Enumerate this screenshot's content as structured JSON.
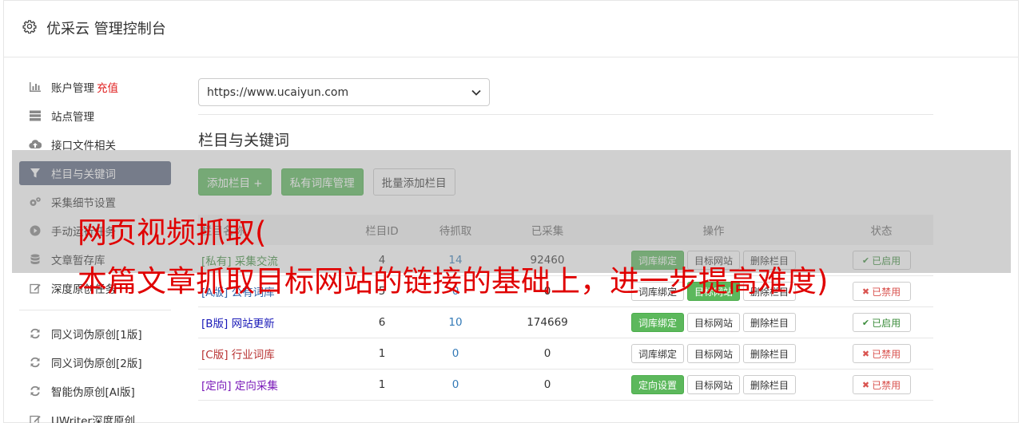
{
  "header": {
    "title": "优采云 管理控制台",
    "icon": "gear-icon"
  },
  "sidebar": {
    "items": [
      {
        "label": "账户管理",
        "extra": "充值",
        "icon": "bar-chart-icon"
      },
      {
        "label": "站点管理",
        "icon": "server-icon"
      },
      {
        "label": "接口文件相关",
        "icon": "cloud-upload-icon"
      },
      {
        "label": "栏目与关键词",
        "icon": "filter-icon"
      },
      {
        "label": "采集细节设置",
        "icon": "cogs-icon"
      },
      {
        "label": "手动运行任务",
        "icon": "play-circle-icon"
      },
      {
        "label": "文章暂存库",
        "icon": "database-icon"
      },
      {
        "label": "深度原创任务",
        "icon": "edit-icon"
      }
    ],
    "items2": [
      {
        "label": "同义词伪原创[1版]",
        "icon": "refresh-icon"
      },
      {
        "label": "同义词伪原创[2版]",
        "icon": "refresh-icon"
      },
      {
        "label": "智能伪原创[AI版]",
        "icon": "refresh-icon"
      },
      {
        "label": "UWriter深度原创",
        "icon": "edit-icon"
      }
    ]
  },
  "main": {
    "site_select": "https://www.ucaiyun.com",
    "section_title": "栏目与关键词",
    "buttons": {
      "add": "添加栏目 +",
      "private": "私有词库管理",
      "batch": "批量添加栏目"
    }
  },
  "table": {
    "headers": {
      "name": "栏目名称",
      "id": "栏目ID",
      "wait": "待抓取",
      "collected": "已采集",
      "ops": "操作",
      "status": "状态"
    },
    "rows": [
      {
        "tag": "[私有]",
        "name": "采集交流",
        "id": "4",
        "wait": "14",
        "collected": "92460",
        "op1": "词库绑定",
        "op1_style": "green",
        "op2": "目标网站",
        "op3": "删除栏目",
        "status": "已启用",
        "on": true,
        "color": "#3c8d3c"
      },
      {
        "tag": "[A版]",
        "name": "公有词库",
        "id": "5",
        "wait": "0",
        "collected": "0",
        "op1": "词库绑定",
        "op1_style": "plain",
        "op2": "目标网站",
        "op2_style": "green",
        "op3": "删除栏目",
        "status": "已禁用",
        "on": false,
        "color": "#3366aa"
      },
      {
        "tag": "[B版]",
        "name": "网站更新",
        "id": "6",
        "wait": "10",
        "collected": "174669",
        "op1": "词库绑定",
        "op1_style": "green",
        "op2": "目标网站",
        "op3": "删除栏目",
        "status": "已启用",
        "on": true,
        "color": "#1a1ab8"
      },
      {
        "tag": "[C版]",
        "name": "行业词库",
        "id": "1",
        "wait": "0",
        "collected": "0",
        "op1": "词库绑定",
        "op1_style": "plain",
        "op2": "目标网站",
        "op3": "删除栏目",
        "status": "已禁用",
        "on": false,
        "color": "#b83232"
      },
      {
        "tag": "[定向]",
        "name": "定向采集",
        "id": "1",
        "wait": "0",
        "collected": "0",
        "op1": "定向设置",
        "op1_style": "green",
        "op2": "目标网站",
        "op3": "删除栏目",
        "status": "已禁用",
        "on": false,
        "color": "#7a1ab8"
      }
    ]
  },
  "watermark": {
    "line1": "网页视频抓取(",
    "line2": "本篇文章抓取目标网站的链接的基础上，进一步提高难度)"
  }
}
